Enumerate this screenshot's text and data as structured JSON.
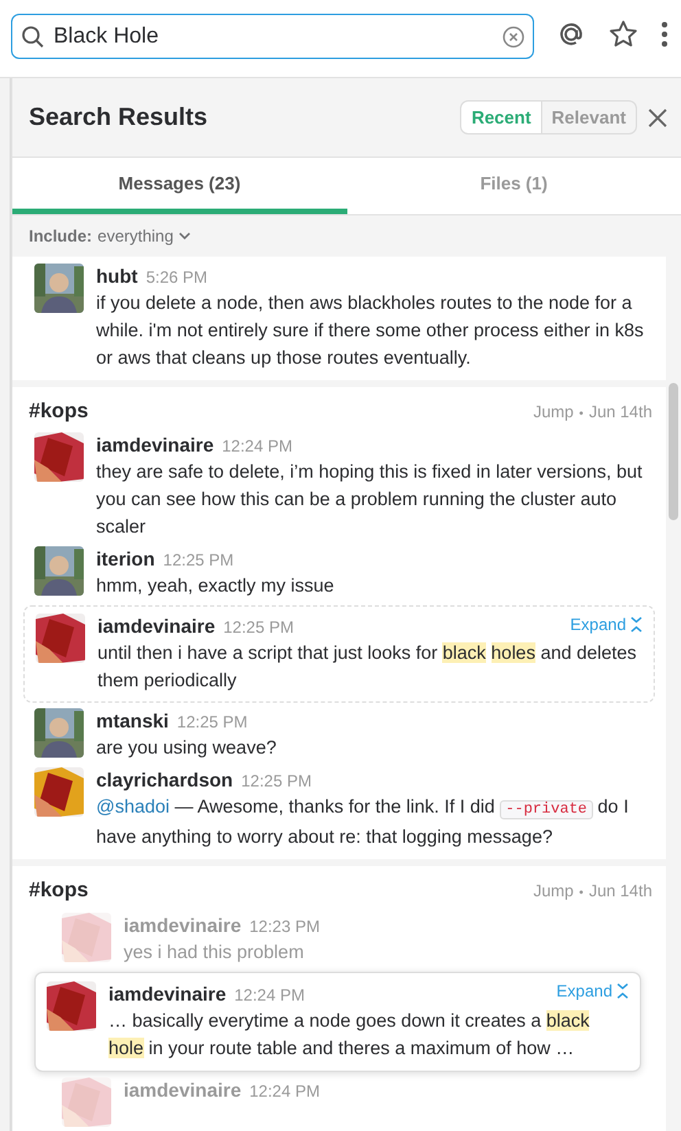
{
  "search": {
    "value": "Black Hole"
  },
  "header": {
    "title": "Search Results",
    "sort": [
      {
        "label": "Recent",
        "selected": true
      },
      {
        "label": "Relevant",
        "selected": false
      }
    ]
  },
  "tabs": [
    {
      "label": "Messages (23)",
      "selected": true
    },
    {
      "label": "Files (1)",
      "selected": false
    }
  ],
  "filter": {
    "label": "Include:",
    "value": "everything"
  },
  "groups": [
    {
      "messages": [
        {
          "kind": "plain",
          "user": "hubt",
          "time": "5:26 PM",
          "avatar": {
            "kind": "picture"
          },
          "text": [
            {
              "kind": "text",
              "text": "if you delete a node, then aws blackholes routes to the node for a while. i'm not entirely sure if there some other process either in k8s or aws that cleans up those routes eventually."
            }
          ]
        }
      ]
    },
    {
      "channel": "#kops",
      "jump": "Jump",
      "separator": "•",
      "date": "Jun 14th",
      "messages": [
        {
          "kind": "plain",
          "user": "iamdevinaire",
          "time": "12:24 PM",
          "avatar": {
            "kind": "tiles",
            "color": "#c0303e"
          },
          "text": [
            {
              "kind": "text",
              "text": "they are safe to delete, i’m hoping this is fixed in later versions, but you can see how this can be a problem running the cluster auto scaler"
            }
          ]
        },
        {
          "kind": "plain",
          "user": "iterion",
          "time": "12:25 PM",
          "avatar": {
            "kind": "picture"
          },
          "text": [
            {
              "kind": "text",
              "text": "hmm, yeah, exactly my issue"
            }
          ]
        },
        {
          "kind": "match",
          "user": "iamdevinaire",
          "time": "12:25 PM",
          "avatar": {
            "kind": "tiles",
            "color": "#c0303e"
          },
          "expand": "Expand",
          "text": [
            {
              "kind": "text",
              "text": "until then i have a script that just looks for "
            },
            {
              "kind": "highlight",
              "text": "black holes"
            },
            {
              "kind": "text",
              "text": " and deletes them periodically"
            }
          ]
        },
        {
          "kind": "plain",
          "user": "mtanski",
          "time": "12:25 PM",
          "avatar": {
            "kind": "picture"
          },
          "text": [
            {
              "kind": "text",
              "text": "are you using weave?"
            }
          ]
        },
        {
          "kind": "plain",
          "user": "clayrichardson",
          "time": "12:25 PM",
          "avatar": {
            "kind": "tiles",
            "color": "#e2a21c"
          },
          "text": [
            {
              "kind": "mention",
              "text": "@shadoi"
            },
            {
              "kind": "text",
              "text": " — Awesome, thanks for the link. If I did "
            },
            {
              "kind": "code",
              "text": "--private"
            },
            {
              "kind": "text",
              "text": " do I have anything to worry about re: that logging message?"
            }
          ]
        }
      ]
    },
    {
      "channel": "#kops",
      "jump": "Jump",
      "separator": "•",
      "date": "Jun 14th",
      "messages": [
        {
          "kind": "faded",
          "user": "iamdevinaire",
          "time": "12:23 PM",
          "avatar": {
            "kind": "tiles"
          },
          "text": [
            {
              "kind": "text",
              "text": "yes i had this problem"
            }
          ]
        },
        {
          "kind": "card",
          "user": "iamdevinaire",
          "time": "12:24 PM",
          "avatar": {
            "kind": "tiles",
            "color": "#c0303e"
          },
          "expand": "Expand",
          "text": [
            {
              "kind": "text",
              "text": "… basically everytime a node goes down it creates a "
            },
            {
              "kind": "highlight",
              "text": "black hole"
            },
            {
              "kind": "text",
              "text": " in your route table and theres a maximum of how …"
            }
          ]
        },
        {
          "kind": "faded",
          "user": "iamdevinaire",
          "time": "12:24 PM",
          "avatar": {
            "kind": "tiles"
          }
        }
      ]
    }
  ]
}
